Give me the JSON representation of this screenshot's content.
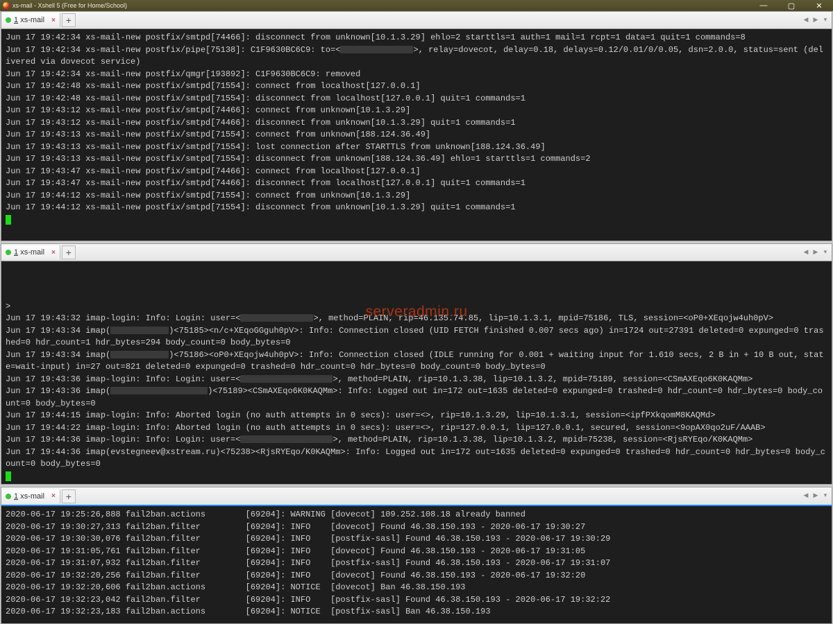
{
  "window": {
    "title": "xs-mail - Xshell 5 (Free for Home/School)",
    "controls": {
      "min": "—",
      "max": "▢",
      "close": "✕"
    }
  },
  "tab": {
    "index": "1",
    "name": "xs-mail",
    "close_glyph": "×",
    "add_glyph": "+",
    "scroll_left": "◀",
    "scroll_right": "▶",
    "menu": "▾"
  },
  "watermark": "serveradmin.ru",
  "pane1_lines": [
    "Jun 17 19:42:34 xs-mail-new postfix/smtpd[74466]: disconnect from unknown[10.1.3.29] ehlo=2 starttls=1 auth=1 mail=1 rcpt=1 data=1 quit=1 commands=8",
    "Jun 17 19:42:34 xs-mail-new postfix/pipe[75138]: C1F9630BC6C9: to=<███████████████>, relay=dovecot, delay=0.18, delays=0.12/0.01/0/0.05, dsn=2.0.0, status=sent (delivered via dovecot service)",
    "Jun 17 19:42:34 xs-mail-new postfix/qmgr[193892]: C1F9630BC6C9: removed",
    "Jun 17 19:42:48 xs-mail-new postfix/smtpd[71554]: connect from localhost[127.0.0.1]",
    "Jun 17 19:42:48 xs-mail-new postfix/smtpd[71554]: disconnect from localhost[127.0.0.1] quit=1 commands=1",
    "Jun 17 19:43:12 xs-mail-new postfix/smtpd[74466]: connect from unknown[10.1.3.29]",
    "Jun 17 19:43:12 xs-mail-new postfix/smtpd[74466]: disconnect from unknown[10.1.3.29] quit=1 commands=1",
    "Jun 17 19:43:13 xs-mail-new postfix/smtpd[71554]: connect from unknown[188.124.36.49]",
    "Jun 17 19:43:13 xs-mail-new postfix/smtpd[71554]: lost connection after STARTTLS from unknown[188.124.36.49]",
    "Jun 17 19:43:13 xs-mail-new postfix/smtpd[71554]: disconnect from unknown[188.124.36.49] ehlo=1 starttls=1 commands=2",
    "Jun 17 19:43:47 xs-mail-new postfix/smtpd[74466]: connect from localhost[127.0.0.1]",
    "Jun 17 19:43:47 xs-mail-new postfix/smtpd[74466]: disconnect from localhost[127.0.0.1] quit=1 commands=1",
    "Jun 17 19:44:12 xs-mail-new postfix/smtpd[71554]: connect from unknown[10.1.3.29]",
    "Jun 17 19:44:12 xs-mail-new postfix/smtpd[71554]: disconnect from unknown[10.1.3.29] quit=1 commands=1"
  ],
  "pane2_lines": [
    ">",
    "Jun 17 19:43:32 imap-login: Info: Login: user=<███████████████>, method=PLAIN, rip=46.135.74.85, lip=10.1.3.1, mpid=75186, TLS, session=<oP0+XEqojw4uh0pV>",
    "Jun 17 19:43:34 imap(████████████)<75185><n/c+XEqoGGguh0pV>: Info: Connection closed (UID FETCH finished 0.007 secs ago) in=1724 out=27391 deleted=0 expunged=0 trashed=0 hdr_count=1 hdr_bytes=294 body_count=0 body_bytes=0",
    "Jun 17 19:43:34 imap(████████████)<75186><oP0+XEqojw4uh0pV>: Info: Connection closed (IDLE running for 0.001 + waiting input for 1.610 secs, 2 B in + 10 B out, state=wait-input) in=27 out=821 deleted=0 expunged=0 trashed=0 hdr_count=0 hdr_bytes=0 body_count=0 body_bytes=0",
    "Jun 17 19:43:36 imap-login: Info: Login: user=<███████████████████>, method=PLAIN, rip=10.1.3.38, lip=10.1.3.2, mpid=75189, session=<CSmAXEqo6K0KAQMm>",
    "Jun 17 19:43:36 imap(████████████████████)<75189><CSmAXEqo6K0KAQMm>: Info: Logged out in=172 out=1635 deleted=0 expunged=0 trashed=0 hdr_count=0 hdr_bytes=0 body_count=0 body_bytes=0",
    "Jun 17 19:44:15 imap-login: Info: Aborted login (no auth attempts in 0 secs): user=<>, rip=10.1.3.29, lip=10.1.3.1, session=<ipfPXkqomM8KAQMd>",
    "Jun 17 19:44:22 imap-login: Info: Aborted login (no auth attempts in 0 secs): user=<>, rip=127.0.0.1, lip=127.0.0.1, secured, session=<9opAX0qo2uF/AAAB>",
    "Jun 17 19:44:36 imap-login: Info: Login: user=<███████████████████>, method=PLAIN, rip=10.1.3.38, lip=10.1.3.2, mpid=75238, session=<RjsRYEqo/K0KAQMm>",
    "Jun 17 19:44:36 imap(evstegneev@xstream.ru)<75238><RjsRYEqo/K0KAQMm>: Info: Logged out in=172 out=1635 deleted=0 expunged=0 trashed=0 hdr_count=0 hdr_bytes=0 body_count=0 body_bytes=0"
  ],
  "pane3_lines": [
    "2020-06-17 19:25:26,888 fail2ban.actions        [69204]: WARNING [dovecot] 109.252.108.18 already banned",
    "2020-06-17 19:30:27,313 fail2ban.filter         [69204]: INFO    [dovecot] Found 46.38.150.193 - 2020-06-17 19:30:27",
    "2020-06-17 19:30:30,076 fail2ban.filter         [69204]: INFO    [postfix-sasl] Found 46.38.150.193 - 2020-06-17 19:30:29",
    "2020-06-17 19:31:05,761 fail2ban.filter         [69204]: INFO    [dovecot] Found 46.38.150.193 - 2020-06-17 19:31:05",
    "2020-06-17 19:31:07,932 fail2ban.filter         [69204]: INFO    [postfix-sasl] Found 46.38.150.193 - 2020-06-17 19:31:07",
    "2020-06-17 19:32:20,256 fail2ban.filter         [69204]: INFO    [dovecot] Found 46.38.150.193 - 2020-06-17 19:32:20",
    "2020-06-17 19:32:20,606 fail2ban.actions        [69204]: NOTICE  [dovecot] Ban 46.38.150.193",
    "2020-06-17 19:32:23,042 fail2ban.filter         [69204]: INFO    [postfix-sasl] Found 46.38.150.193 - 2020-06-17 19:32:22",
    "2020-06-17 19:32:23,183 fail2ban.actions        [69204]: NOTICE  [postfix-sasl] Ban 46.38.150.193"
  ]
}
